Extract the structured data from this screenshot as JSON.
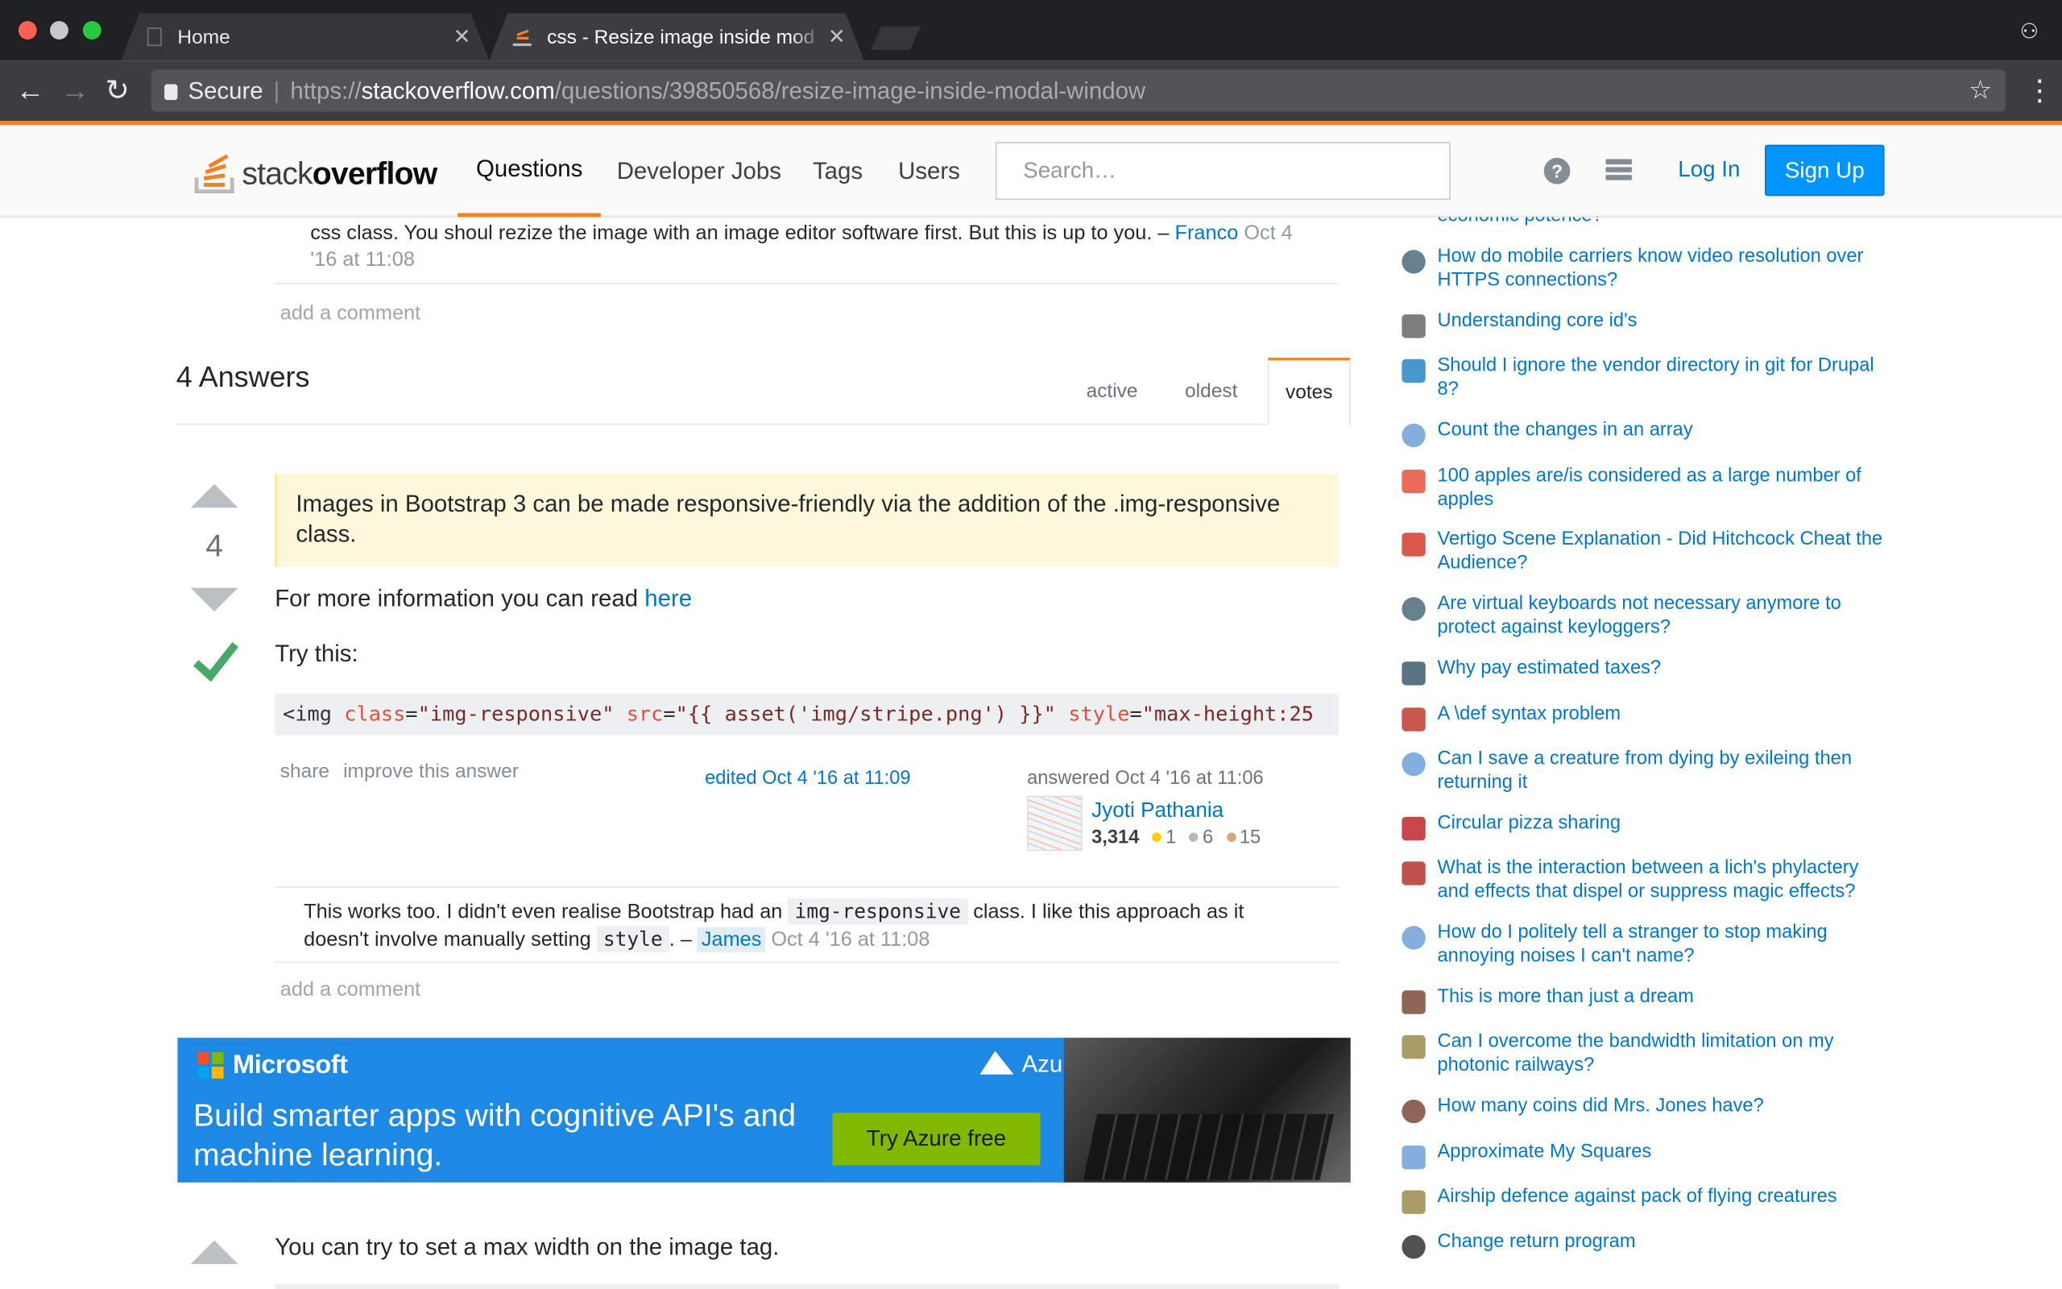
{
  "browser": {
    "tabs": [
      {
        "label": "Home"
      },
      {
        "label": "css - Resize image inside mod"
      }
    ],
    "secure_label": "Secure",
    "url_scheme": "https://",
    "url_host": "stackoverflow.com",
    "url_path": "/questions/39850568/resize-image-inside-modal-window"
  },
  "topbar": {
    "logo_light": "stack",
    "logo_bold": "overflow",
    "nav": [
      "Questions",
      "Developer Jobs",
      "Tags",
      "Users"
    ],
    "search_placeholder": "Search…",
    "login": "Log In",
    "signup": "Sign Up"
  },
  "question_comment": {
    "text": "css class. You shoul rezize the image with an image editor software first. But this is up to you. –",
    "user": "Franco",
    "date_line1": "Oct 4",
    "date_line2": "'16 at 11:08",
    "add_comment": "add a comment"
  },
  "answers": {
    "heading": "4 Answers",
    "sort_tabs": [
      "active",
      "oldest",
      "votes"
    ]
  },
  "answer1": {
    "votes": "4",
    "blockquote": "Images in Bootstrap 3 can be made responsive-friendly via the addition of the .img-responsive class.",
    "more_info_prefix": "For more information you can read",
    "more_info_link": "here",
    "try_this": "Try this:",
    "code": {
      "open": "<img",
      "class_attr": "class",
      "class_val": "\"img-responsive\"",
      "src_attr": "src",
      "src_val": "\"{{ asset('img/stripe.png') }}\"",
      "style_attr": "style",
      "style_val": "\"max-height:25"
    },
    "share": "share",
    "improve": "improve this answer",
    "edited": "edited Oct 4 '16 at 11:09",
    "answered": "answered Oct 4 '16 at 11:06",
    "user": "Jyoti Pathania",
    "rep": "3,314",
    "gold": "1",
    "silver": "6",
    "bronze": "15",
    "comment": {
      "t1": "This works too. I didn't even realise Bootstrap had an",
      "code1": "img-responsive",
      "t2": "class. I like this approach as it",
      "t3": "doesn't involve manually setting",
      "code2": "style",
      "t4": ". –",
      "user": "James",
      "date": "Oct 4 '16 at 11:08"
    },
    "add_comment": "add a comment"
  },
  "ad": {
    "brand": "Microsoft",
    "headline": "Build smarter apps with cognitive API's and machine learning.",
    "product": "Azure",
    "cta": "Try Azure free"
  },
  "answer2": {
    "text": "You can try to set a max width on the image tag."
  },
  "sidebar": {
    "partial_top": "economic potence?",
    "hot_questions": [
      {
        "icon": "security-se-icon",
        "color": "#4a6a7a",
        "text": "How do mobile carriers know video resolution over HTTPS connections?"
      },
      {
        "icon": "unix-linux-se-icon",
        "color": "#666",
        "text": "Understanding core id's"
      },
      {
        "icon": "drupal-se-icon",
        "color": "#2a84c6",
        "text": "Should I ignore the vendor directory in git for Drupal 8?"
      },
      {
        "icon": "codegolf-se-icon",
        "color": "#6fa0d8",
        "text": "Count the changes in an array"
      },
      {
        "icon": "english-se-icon",
        "color": "#e5513c",
        "text": "100 apples are/is considered as a large number of apples"
      },
      {
        "icon": "movies-se-icon",
        "color": "#d43a2f",
        "text": "Vertigo Scene Explanation - Did Hitchcock Cheat the Audience?"
      },
      {
        "icon": "security-se-icon",
        "color": "#4a6a7a",
        "text": "Are virtual keyboards not necessary anymore to protect against keyloggers?"
      },
      {
        "icon": "money-se-icon",
        "color": "#3c5b6f",
        "text": "Why pay estimated taxes?"
      },
      {
        "icon": "tex-se-icon",
        "color": "#c0392b",
        "text": "A \\def syntax problem"
      },
      {
        "icon": "boardgames-se-icon",
        "color": "#6fa0d8",
        "text": "Can I save a creature from dying by exileing then returning it"
      },
      {
        "icon": "puzzling-se-icon",
        "color": "#c0262b",
        "text": "Circular pizza sharing"
      },
      {
        "icon": "rpg-se-icon",
        "color": "#b5322e",
        "text": "What is the interaction between a lich's phylactery and effects that dispel or suppress magic effects?"
      },
      {
        "icon": "interpersonal-se-icon",
        "color": "#6fa0d8",
        "text": "How do I politely tell a stranger to stop making annoying noises I can't name?"
      },
      {
        "icon": "math-se-icon",
        "color": "#7d4a3a",
        "text": "This is more than just a dream"
      },
      {
        "icon": "worldbuilding-se-icon",
        "color": "#9c8a4a",
        "text": "Can I overcome the bandwidth limitation on my photonic railways?"
      },
      {
        "icon": "math-se-icon",
        "color": "#7d4a3a",
        "text": "How many coins did Mrs. Jones have?"
      },
      {
        "icon": "codegolf-se-icon",
        "color": "#6fa0d8",
        "text": "Approximate My Squares"
      },
      {
        "icon": "worldbuilding-se-icon",
        "color": "#9c8a4a",
        "text": "Airship defence against pack of flying creatures"
      },
      {
        "icon": "codereview-se-icon",
        "color": "#333",
        "text": "Change return program"
      }
    ]
  }
}
